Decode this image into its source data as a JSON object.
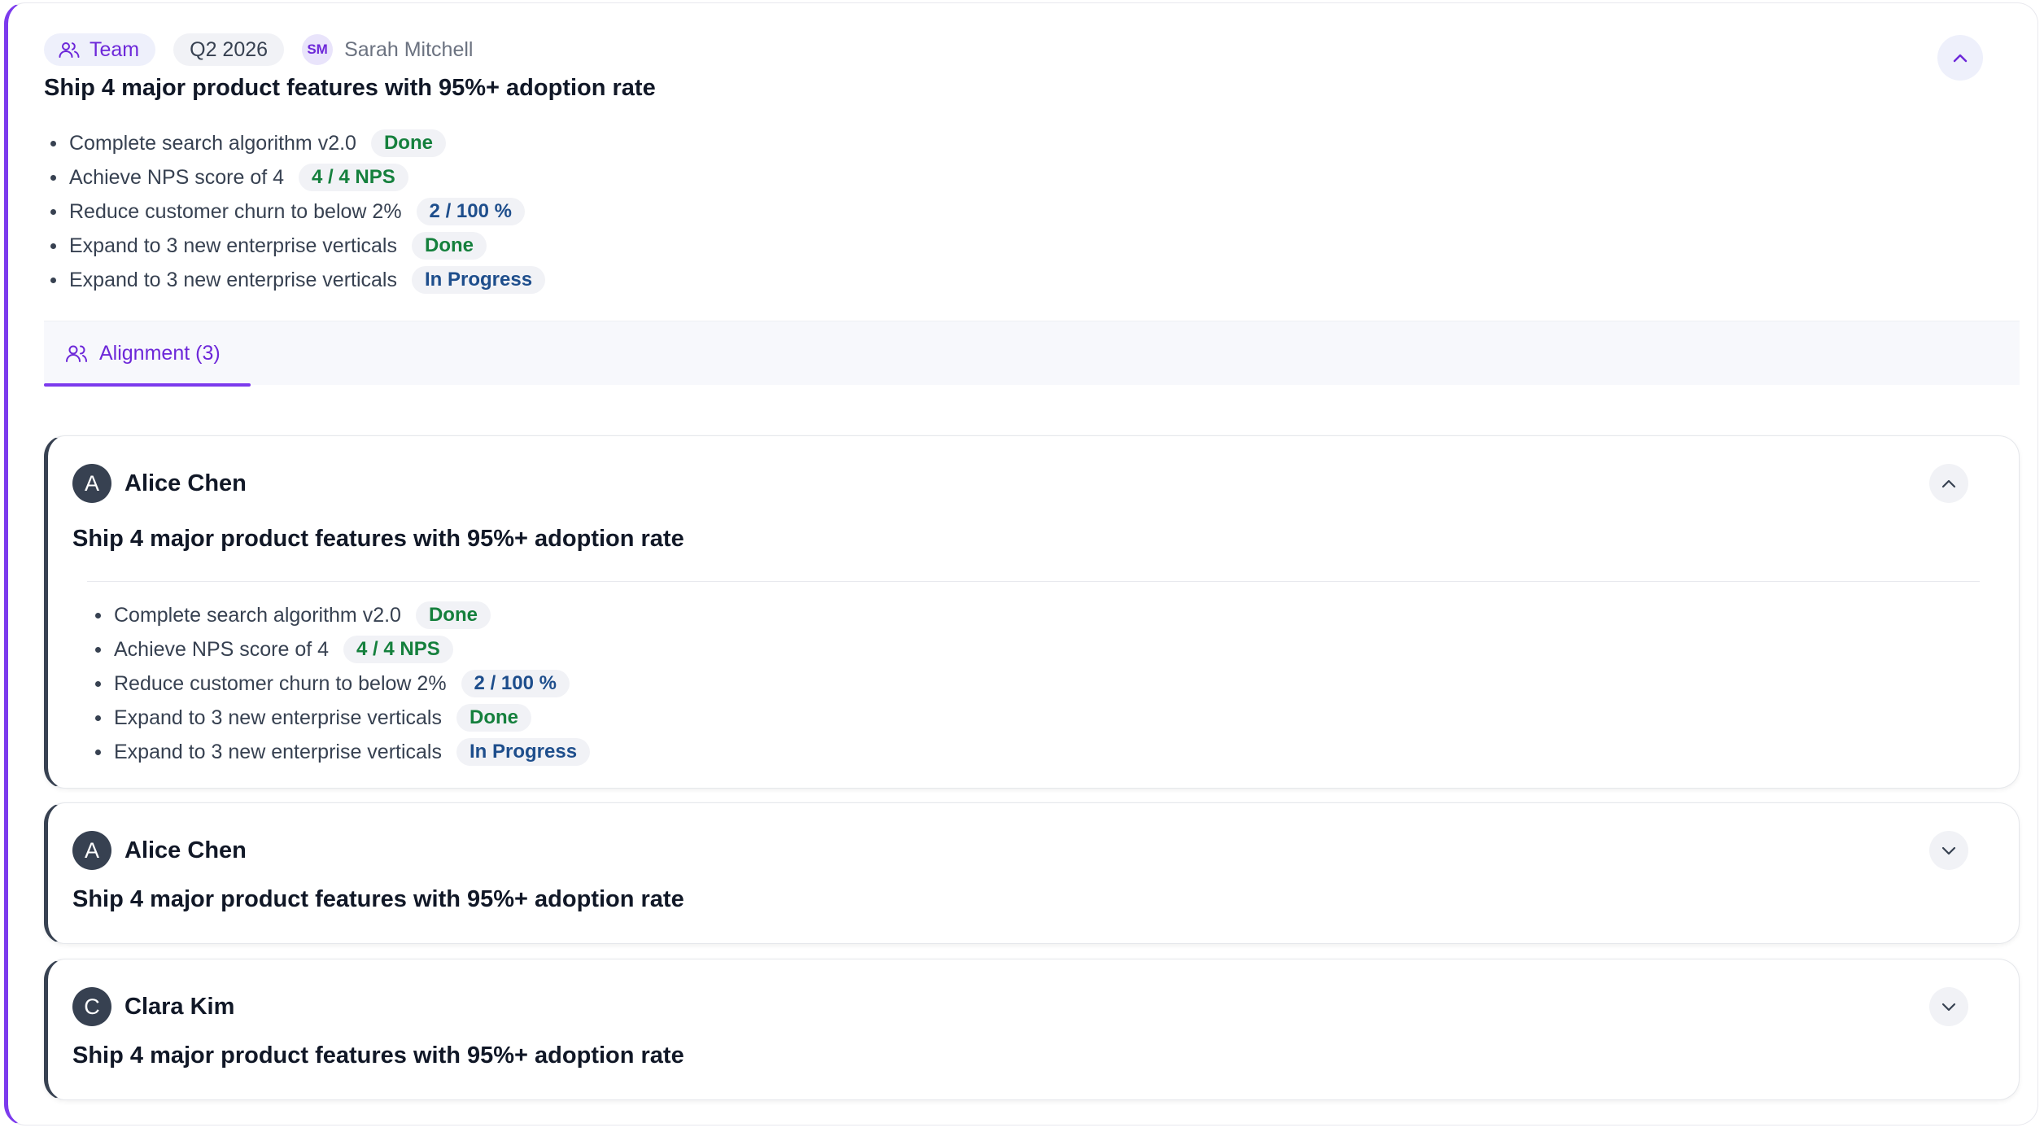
{
  "objective": {
    "level": "Team",
    "period": "Q2 2026",
    "owner": {
      "initials": "SM",
      "name": "Sarah Mitchell"
    },
    "title": "Ship 4 major product features with 95%+ adoption rate",
    "key_results": [
      {
        "text": "Complete search algorithm v2.0",
        "status": "Done",
        "tone": "green"
      },
      {
        "text": "Achieve NPS score of 4",
        "status": "4 / 4 NPS",
        "tone": "green"
      },
      {
        "text": "Reduce customer churn to below 2%",
        "status": "2 / 100 %",
        "tone": "blue"
      },
      {
        "text": "Expand to 3 new enterprise verticals",
        "status": "Done",
        "tone": "green"
      },
      {
        "text": "Expand to 3 new enterprise verticals",
        "status": "In Progress",
        "tone": "blue"
      }
    ]
  },
  "tabs": [
    {
      "label": "Alignment (3)",
      "active": true
    }
  ],
  "alignments": [
    {
      "initial": "A",
      "name": "Alice Chen",
      "title": "Ship 4 major product features with 95%+ adoption rate",
      "expanded": true,
      "key_results": [
        {
          "text": "Complete search algorithm v2.0",
          "status": "Done",
          "tone": "green"
        },
        {
          "text": "Achieve NPS score of 4",
          "status": "4 / 4 NPS",
          "tone": "green"
        },
        {
          "text": "Reduce customer churn to below 2%",
          "status": "2 / 100 %",
          "tone": "blue"
        },
        {
          "text": "Expand to 3 new enterprise verticals",
          "status": "Done",
          "tone": "green"
        },
        {
          "text": "Expand to 3 new enterprise verticals",
          "status": "In Progress",
          "tone": "blue"
        }
      ]
    },
    {
      "initial": "A",
      "name": "Alice Chen",
      "title": "Ship 4 major product features with 95%+ adoption rate",
      "expanded": false
    },
    {
      "initial": "C",
      "name": "Clara Kim",
      "title": "Ship 4 major product features with 95%+ adoption rate",
      "expanded": false
    }
  ],
  "icons": {
    "collapse": "chevron-up-icon",
    "expand": "chevron-down-icon",
    "team": "users-icon"
  },
  "colors": {
    "accent": "#7c3aed",
    "done": "#15803d",
    "progress": "#1e4e8c",
    "sub_border": "#374151"
  }
}
